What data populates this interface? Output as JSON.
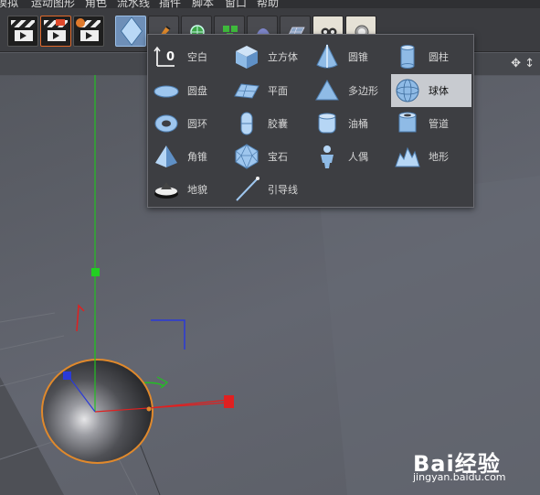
{
  "menubar": {
    "items": [
      "模拟",
      "运动图形",
      "角色",
      "流水线",
      "插件",
      "脚本",
      "窗口",
      "帮助"
    ]
  },
  "viewport": {
    "nav_icons": "✥ ↕"
  },
  "object_menu": {
    "columns": [
      [
        {
          "label": "空白",
          "icon": "null-object-icon"
        },
        {
          "label": "圆盘",
          "icon": "disc-icon"
        },
        {
          "label": "圆环",
          "icon": "torus-icon"
        },
        {
          "label": "角锥",
          "icon": "pyramid-icon"
        },
        {
          "label": "地貌",
          "icon": "landscape-icon"
        }
      ],
      [
        {
          "label": "立方体",
          "icon": "cube-icon"
        },
        {
          "label": "平面",
          "icon": "plane-icon"
        },
        {
          "label": "胶囊",
          "icon": "capsule-icon"
        },
        {
          "label": "宝石",
          "icon": "gem-icon"
        },
        {
          "label": "引导线",
          "icon": "guide-line-icon"
        }
      ],
      [
        {
          "label": "圆锥",
          "icon": "cone-icon"
        },
        {
          "label": "多边形",
          "icon": "polygon-icon"
        },
        {
          "label": "油桶",
          "icon": "oil-tank-icon"
        },
        {
          "label": "人偶",
          "icon": "figure-icon"
        }
      ],
      [
        {
          "label": "圆柱",
          "icon": "cylinder-icon"
        },
        {
          "label": "球体",
          "icon": "sphere-icon",
          "highlighted": true
        },
        {
          "label": "管道",
          "icon": "tube-icon"
        },
        {
          "label": "地形",
          "icon": "landscape-terrain-icon"
        }
      ]
    ]
  },
  "watermark": {
    "logo": "Bai经验",
    "url": "jingyan.baidu.com"
  },
  "colors": {
    "accent_orange": "#e0892c",
    "axis_x": "#e02020",
    "axis_y": "#22c022",
    "axis_z": "#2a3ad8",
    "highlight": "#c8cbd0"
  }
}
